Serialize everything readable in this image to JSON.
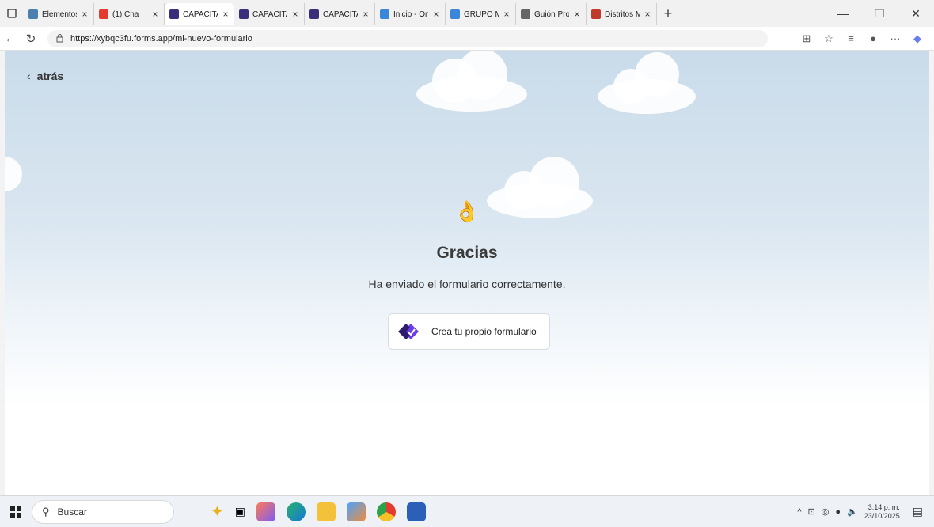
{
  "browser": {
    "tabs": [
      {
        "title": "Elementos",
        "favicon_color": "#4a7fb0",
        "active": false
      },
      {
        "title": "(1) Cha",
        "favicon_color": "#e33b2e",
        "active": false
      },
      {
        "title": "CAPACITAC",
        "favicon_color": "#3a2d7a",
        "active": true
      },
      {
        "title": "CAPACITAC",
        "favicon_color": "#3a2d7a",
        "active": false
      },
      {
        "title": "CAPACITAC",
        "favicon_color": "#3a2d7a",
        "active": false
      },
      {
        "title": "Inicio - One",
        "favicon_color": "#3a86d8",
        "active": false
      },
      {
        "title": "GRUPO ME",
        "favicon_color": "#3a86d8",
        "active": false
      },
      {
        "title": "Guión Prop",
        "favicon_color": "#666666",
        "active": false
      },
      {
        "title": "Distritos M",
        "favicon_color": "#c0392b",
        "active": false
      }
    ],
    "new_tab": "+",
    "url": "https://xybqc3fu.forms.app/mi-nuevo-formulario"
  },
  "page": {
    "back_label": "atrás",
    "emoji": "👌",
    "title": "Gracias",
    "subtitle": "Ha enviado el formulario correctamente.",
    "cta_label": "Crea tu propio formulario",
    "brand_color": "#6a3de8"
  },
  "taskbar": {
    "search_placeholder": "Buscar",
    "time": "3:14 p. m.",
    "date": "23/10/2025"
  }
}
